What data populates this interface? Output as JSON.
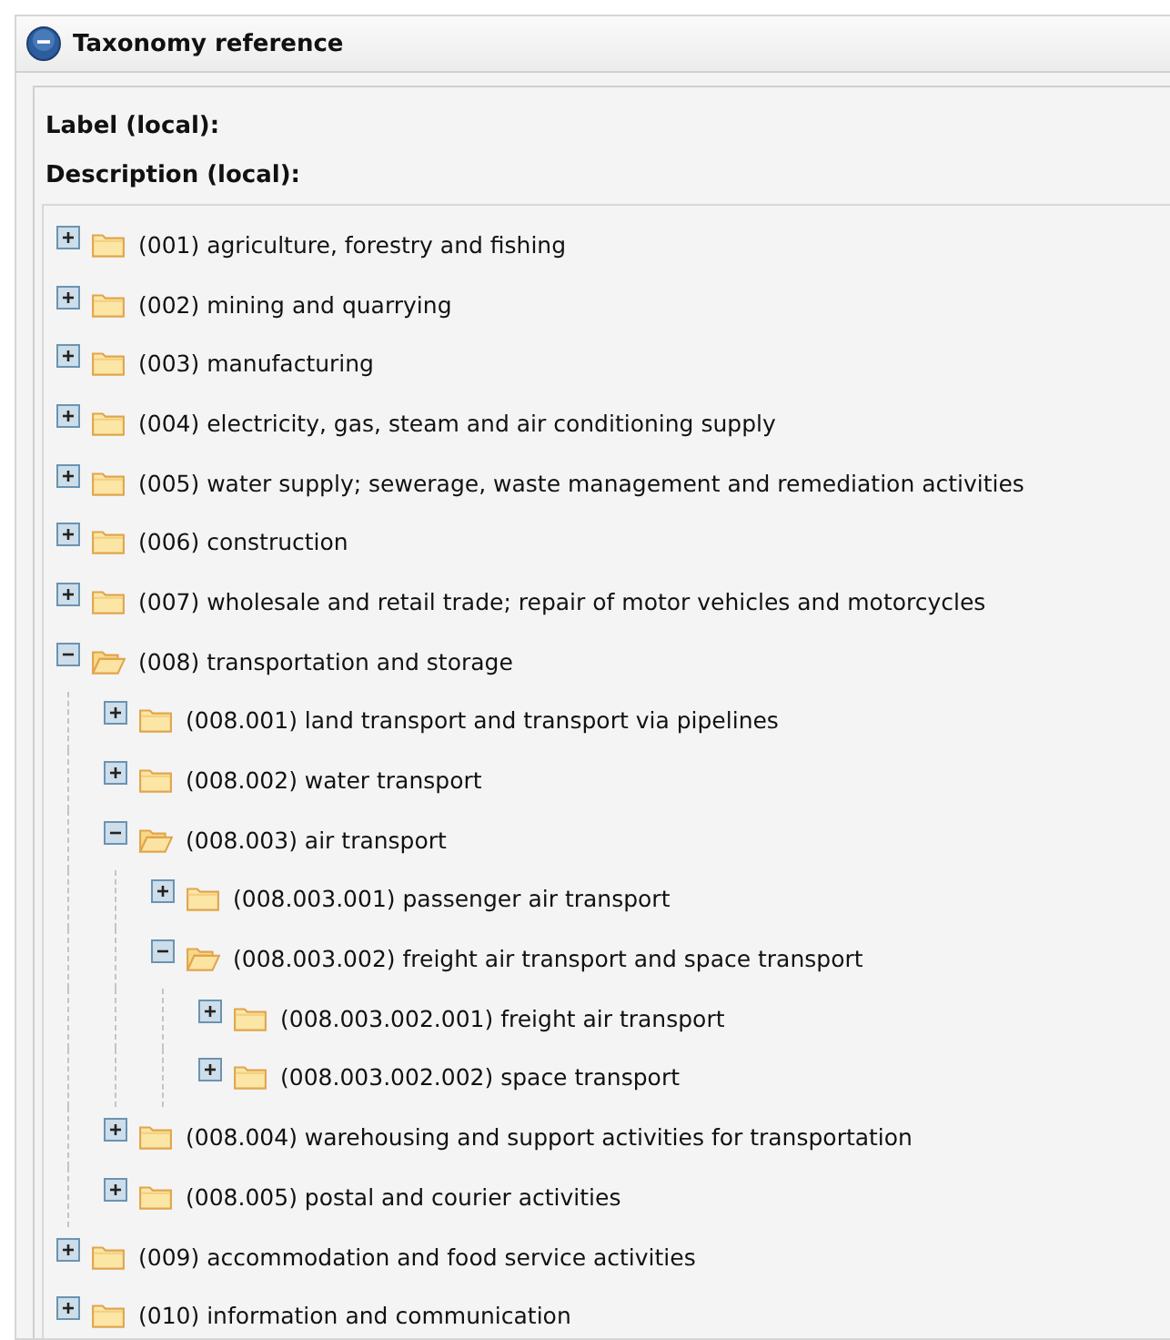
{
  "panel": {
    "title": "Taxonomy reference",
    "collapsed": false
  },
  "fields": [
    {
      "label": "Label (local):"
    },
    {
      "label": "Description (local):"
    }
  ],
  "tree": [
    {
      "label": "(001) agriculture, forestry and fishing",
      "expanded": false
    },
    {
      "label": "(002) mining and quarrying",
      "expanded": false
    },
    {
      "label": "(003) manufacturing",
      "expanded": false
    },
    {
      "label": "(004) electricity, gas, steam and air conditioning supply",
      "expanded": false
    },
    {
      "label": "(005) water supply; sewerage, waste management and remediation activities",
      "expanded": false
    },
    {
      "label": "(006) construction",
      "expanded": false
    },
    {
      "label": "(007) wholesale and retail trade; repair of motor vehicles and motorcycles",
      "expanded": false
    },
    {
      "label": "(008) transportation and storage",
      "expanded": true,
      "children": [
        {
          "label": "(008.001) land transport and transport via pipelines",
          "expanded": false
        },
        {
          "label": "(008.002) water transport",
          "expanded": false
        },
        {
          "label": "(008.003) air transport",
          "expanded": true,
          "children": [
            {
              "label": "(008.003.001) passenger air transport",
              "expanded": false
            },
            {
              "label": "(008.003.002) freight air transport and space transport",
              "expanded": true,
              "children": [
                {
                  "label": "(008.003.002.001) freight air transport",
                  "expanded": false
                },
                {
                  "label": "(008.003.002.002) space transport",
                  "expanded": false
                }
              ]
            }
          ]
        },
        {
          "label": "(008.004) warehousing and support activities for transportation",
          "expanded": false
        },
        {
          "label": "(008.005) postal and courier activities",
          "expanded": false
        }
      ]
    },
    {
      "label": "(009) accommodation and food service activities",
      "expanded": false
    },
    {
      "label": "(010) information and communication",
      "expanded": false
    }
  ]
}
